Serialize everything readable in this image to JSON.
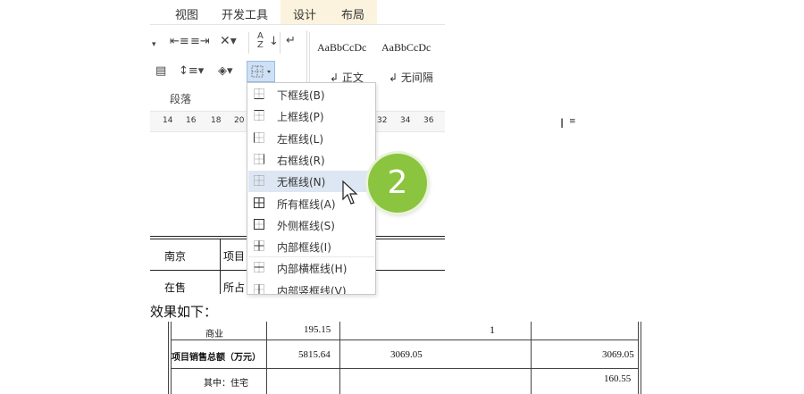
{
  "ribbon": {
    "tabs": [
      {
        "label": "视图"
      },
      {
        "label": "开发工具"
      },
      {
        "label": "设计"
      },
      {
        "label": "布局"
      }
    ],
    "styles": [
      {
        "sample": "AaBbCcDc",
        "name": "正文"
      },
      {
        "sample": "AaBbCcDc",
        "name": "无间隔"
      }
    ],
    "group_label": "段落",
    "sort_label": "A↓Z"
  },
  "ruler": {
    "ticks": [
      "14",
      "16",
      "18",
      "20",
      "32",
      "34",
      "36"
    ]
  },
  "document": {
    "cells": [
      {
        "text": "南京"
      },
      {
        "text": "项目"
      },
      {
        "text": "在售"
      },
      {
        "text": "所占"
      }
    ]
  },
  "border_menu": {
    "items": [
      {
        "label": "下框线(B)",
        "icon": "bottom-border-icon"
      },
      {
        "label": "上框线(P)",
        "icon": "top-border-icon"
      },
      {
        "label": "左框线(L)",
        "icon": "left-border-icon"
      },
      {
        "label": "右框线(R)",
        "icon": "right-border-icon"
      },
      {
        "label": "无框线(N)",
        "icon": "no-border-icon"
      },
      {
        "label": "所有框线(A)",
        "icon": "all-borders-icon"
      },
      {
        "label": "外侧框线(S)",
        "icon": "outside-borders-icon"
      },
      {
        "label": "内部框线(I)",
        "icon": "inside-borders-icon"
      },
      {
        "label": "内部横框线(H)",
        "icon": "inside-horizontal-border-icon"
      },
      {
        "label": "内部竖框线(V)",
        "icon": "inside-vertical-border-icon"
      }
    ],
    "highlighted_index": 4
  },
  "step_badge": "2",
  "caption": "效果如下：",
  "result_table": {
    "rows": [
      {
        "label": "商业",
        "c1": "195.15",
        "c2": "",
        "c3": "",
        "c4": ""
      },
      {
        "label": "项目销售总额（万元）",
        "c1": "5815.64",
        "c2": "3069.05",
        "c3": "",
        "c4": "3069.05"
      },
      {
        "label": "其中：住宅",
        "c1": "",
        "c2": "",
        "c3": "",
        "c4": "160.55"
      }
    ],
    "cursor_mark": "1"
  },
  "colors": {
    "accent_tab": "#fbf3dd",
    "highlight": "#dde7f3",
    "badge": "#8bc53f"
  }
}
